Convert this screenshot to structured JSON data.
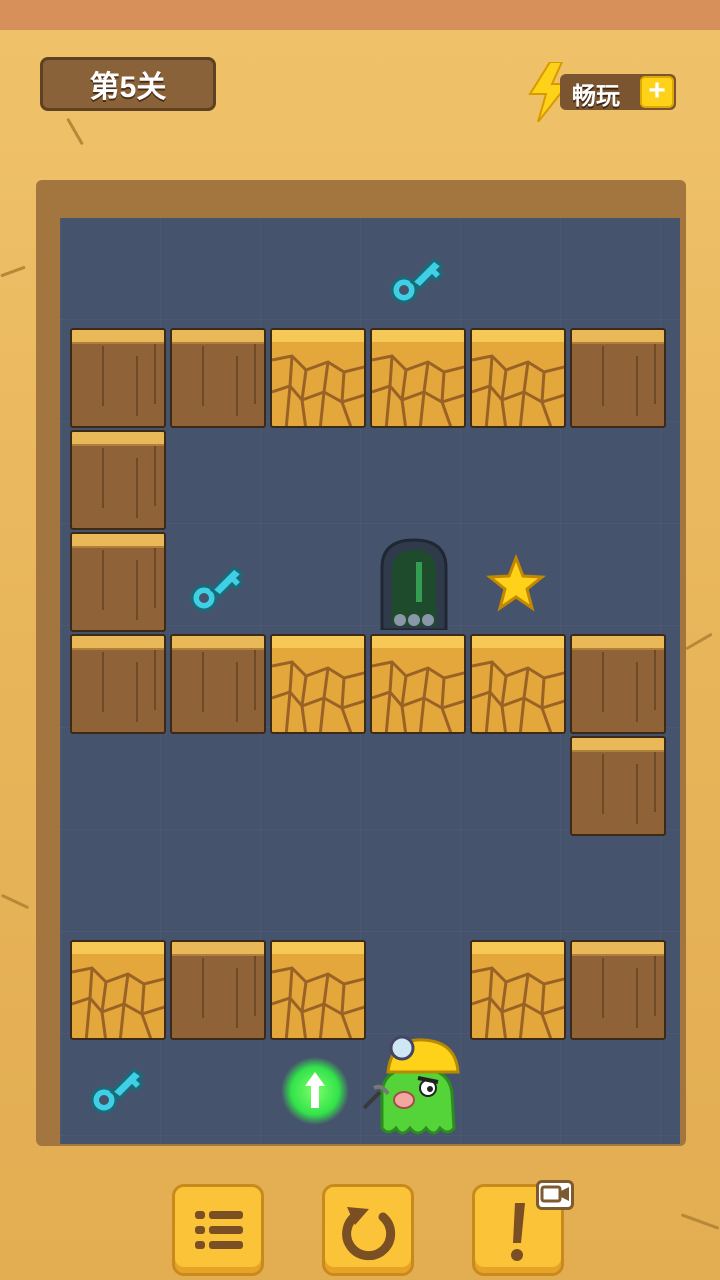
{
  "header": {
    "level_label": "第5关",
    "play_plus_label": "畅玩",
    "play_plus_icon": "lightning-bolt-icon",
    "plus_icon": "plus-icon"
  },
  "board": {
    "tiles": [
      {
        "type": "dirt",
        "row": 1,
        "col": 0
      },
      {
        "type": "dirt",
        "row": 1,
        "col": 1
      },
      {
        "type": "cracked",
        "row": 1,
        "col": 2
      },
      {
        "type": "cracked",
        "row": 1,
        "col": 3
      },
      {
        "type": "cracked",
        "row": 1,
        "col": 4
      },
      {
        "type": "dirt",
        "row": 1,
        "col": 5
      },
      {
        "type": "dirt",
        "row": 2,
        "col": 0
      },
      {
        "type": "dirt",
        "row": 3,
        "col": 0
      },
      {
        "type": "dirt",
        "row": 4,
        "col": 0
      },
      {
        "type": "dirt",
        "row": 4,
        "col": 1
      },
      {
        "type": "cracked",
        "row": 4,
        "col": 2
      },
      {
        "type": "cracked",
        "row": 4,
        "col": 3
      },
      {
        "type": "cracked",
        "row": 4,
        "col": 4
      },
      {
        "type": "dirt",
        "row": 4,
        "col": 5
      },
      {
        "type": "dirt",
        "row": 5,
        "col": 5
      },
      {
        "type": "cracked",
        "row": 7,
        "col": 0
      },
      {
        "type": "dirt",
        "row": 7,
        "col": 1
      },
      {
        "type": "cracked",
        "row": 7,
        "col": 2
      },
      {
        "type": "cracked",
        "row": 7,
        "col": 4
      },
      {
        "type": "dirt",
        "row": 7,
        "col": 5
      }
    ],
    "items": [
      {
        "name": "key",
        "icon": "key-icon",
        "row": 0,
        "col": 3
      },
      {
        "name": "key",
        "icon": "key-icon",
        "row": 3,
        "col": 1
      },
      {
        "name": "key",
        "icon": "key-icon",
        "row": 8,
        "col": 0
      },
      {
        "name": "star",
        "icon": "star-icon",
        "row": 3,
        "col": 4
      },
      {
        "name": "exit-door",
        "icon": "door-icon",
        "row": 3,
        "col": 3
      },
      {
        "name": "player",
        "icon": "miner-monster-icon",
        "row": 8,
        "col": 3
      },
      {
        "name": "move-hint",
        "icon": "up-arrow-icon",
        "row": 8,
        "col": 2
      }
    ],
    "colors": {
      "board": "#46536c",
      "dirt": "#8f6238",
      "cracked": "#e3a73c",
      "key": "#3fd0e6",
      "hint": "#33e34a"
    }
  },
  "controls": [
    {
      "name": "menu-button",
      "icon": "list-icon"
    },
    {
      "name": "restart-button",
      "icon": "undo-icon"
    },
    {
      "name": "hint-button",
      "icon": "exclamation-icon",
      "badge_icon": "video-icon"
    }
  ]
}
